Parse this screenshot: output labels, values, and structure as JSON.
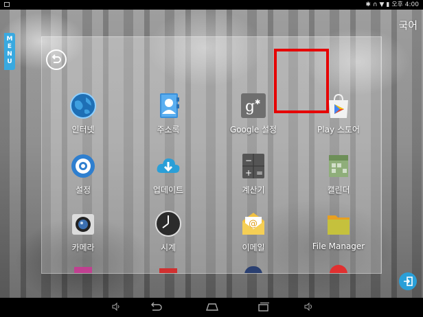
{
  "status_bar": {
    "time": "오후 4:00"
  },
  "language_button": "국어",
  "menu_tab": [
    "M",
    "E",
    "N",
    "U"
  ],
  "apps": [
    {
      "label": "인터넷",
      "icon": "globe-icon"
    },
    {
      "label": "주소록",
      "icon": "contacts-icon"
    },
    {
      "label": "Google 설정",
      "icon": "google-settings-icon"
    },
    {
      "label": "Play 스토어",
      "icon": "play-store-icon"
    },
    {
      "label": "설정",
      "icon": "settings-gear-icon"
    },
    {
      "label": "업데이트",
      "icon": "cloud-download-icon"
    },
    {
      "label": "계산기",
      "icon": "calculator-icon"
    },
    {
      "label": "캘린더",
      "icon": "calendar-icon"
    },
    {
      "label": "카메라",
      "icon": "camera-icon"
    },
    {
      "label": "시계",
      "icon": "clock-icon"
    },
    {
      "label": "이메일",
      "icon": "email-icon"
    },
    {
      "label": "File Manager",
      "icon": "folder-icon"
    }
  ],
  "highlight_color": "#e60000",
  "accent_color": "#39a9e0"
}
